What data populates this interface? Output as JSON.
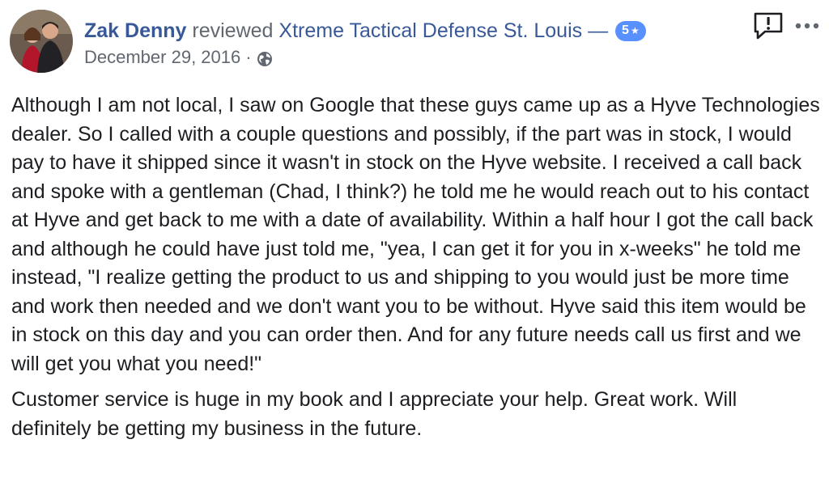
{
  "review": {
    "author": "Zak Denny",
    "action": "reviewed",
    "page_name": "Xtreme Tactical Defense St. Louis",
    "dash": "—",
    "rating": "5",
    "rating_icon": "star-icon",
    "date": "December 29, 2016",
    "meta_separator": "·",
    "privacy_icon": "globe-icon",
    "paragraphs": [
      "Although I am not local, I saw on Google that these guys came up as a Hyve Technologies dealer. So I called with a couple questions and possibly, if the part was in stock, I would pay to have it shipped since it wasn't in stock on the Hyve website. I received a call back and spoke with a gentleman (Chad, I think?) he told me he would reach out to his contact at Hyve and get back to me with a date of availability. Within a half hour I got the call back and although he could have just told me, \"yea, I can get it for you in x-weeks\" he told me instead, \"I realize getting the product to us and shipping to you would just be more time and work then needed and we don't want you to be without. Hyve said this item would be in stock on this day and you can order then. And for any future needs call us first and we will get you what you need!\"",
      "Customer service is huge in my book and I appreciate your help. Great work. Will definitely be getting my business in the future."
    ]
  },
  "colors": {
    "link": "#385898",
    "secondary_text": "#606770",
    "badge": "#5890ff",
    "body_text": "#1c1e21"
  }
}
